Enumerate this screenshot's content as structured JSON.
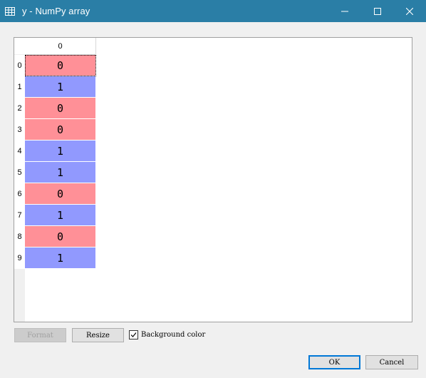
{
  "window": {
    "title": "y - NumPy array",
    "icon": "table-grid-icon",
    "controls": [
      "minimize-icon",
      "maximize-icon",
      "close-icon"
    ]
  },
  "table": {
    "column_headers": [
      "0"
    ],
    "rows": [
      {
        "index": "0",
        "value": "0"
      },
      {
        "index": "1",
        "value": "1"
      },
      {
        "index": "2",
        "value": "0"
      },
      {
        "index": "3",
        "value": "0"
      },
      {
        "index": "4",
        "value": "1"
      },
      {
        "index": "5",
        "value": "1"
      },
      {
        "index": "6",
        "value": "0"
      },
      {
        "index": "7",
        "value": "1"
      },
      {
        "index": "8",
        "value": "0"
      },
      {
        "index": "9",
        "value": "1"
      }
    ],
    "selected_row": 0,
    "colors": {
      "zero": "#ff9097",
      "one": "#9199fe"
    }
  },
  "toolbar": {
    "format_label": "Format",
    "resize_label": "Resize",
    "background_color_label": "Background color",
    "background_color_checked": true
  },
  "dialog": {
    "ok_label": "OK",
    "cancel_label": "Cancel"
  },
  "colors": {
    "titlebar": "#2a7ea6",
    "accent": "#0078d7"
  }
}
